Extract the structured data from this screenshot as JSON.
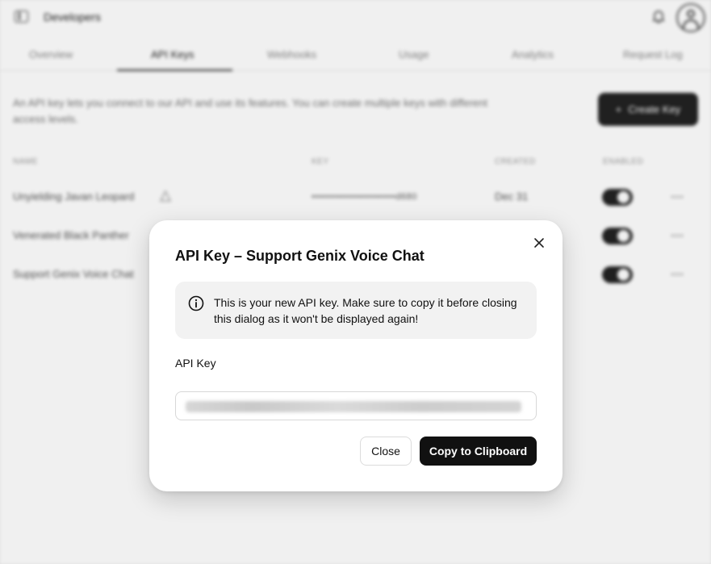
{
  "app": {
    "title": "Developers",
    "tabs": [
      "Overview",
      "API Keys",
      "Webhooks",
      "Usage",
      "Analytics",
      "Request Log"
    ],
    "description": "An API key lets you connect to our API and use its features. You can create multiple keys with different access levels.",
    "create_button": "Create Key",
    "table": {
      "headers": [
        "NAME",
        "KEY",
        "CREATED",
        "ENABLED"
      ],
      "rows": [
        {
          "name": "Unyielding Javan Leopard",
          "key": "••••••••••••••••••••••••d680",
          "created": "Dec 31",
          "enabled": true
        },
        {
          "name": "Venerated Black Panther",
          "key": "",
          "created": "",
          "enabled": true
        },
        {
          "name": "Support Genix Voice Chat",
          "key": "",
          "created": "",
          "enabled": true
        }
      ]
    }
  },
  "dialog": {
    "title": "API Key – Support Genix Voice Chat",
    "notice": "This is your new API key. Make sure to copy it before closing this dialog as it won't be displayed again!",
    "field_label": "API Key",
    "key_value": "",
    "close_button": "Close",
    "copy_button": "Copy to Clipboard"
  },
  "icons": {
    "sidebar_toggle": "sidebar-toggle-icon",
    "bell": "bell-icon",
    "avatar": "user-avatar",
    "plus": "plus-icon",
    "warning": "warning-icon",
    "more": "more-dots-icon",
    "close": "close-icon",
    "info": "info-icon"
  }
}
